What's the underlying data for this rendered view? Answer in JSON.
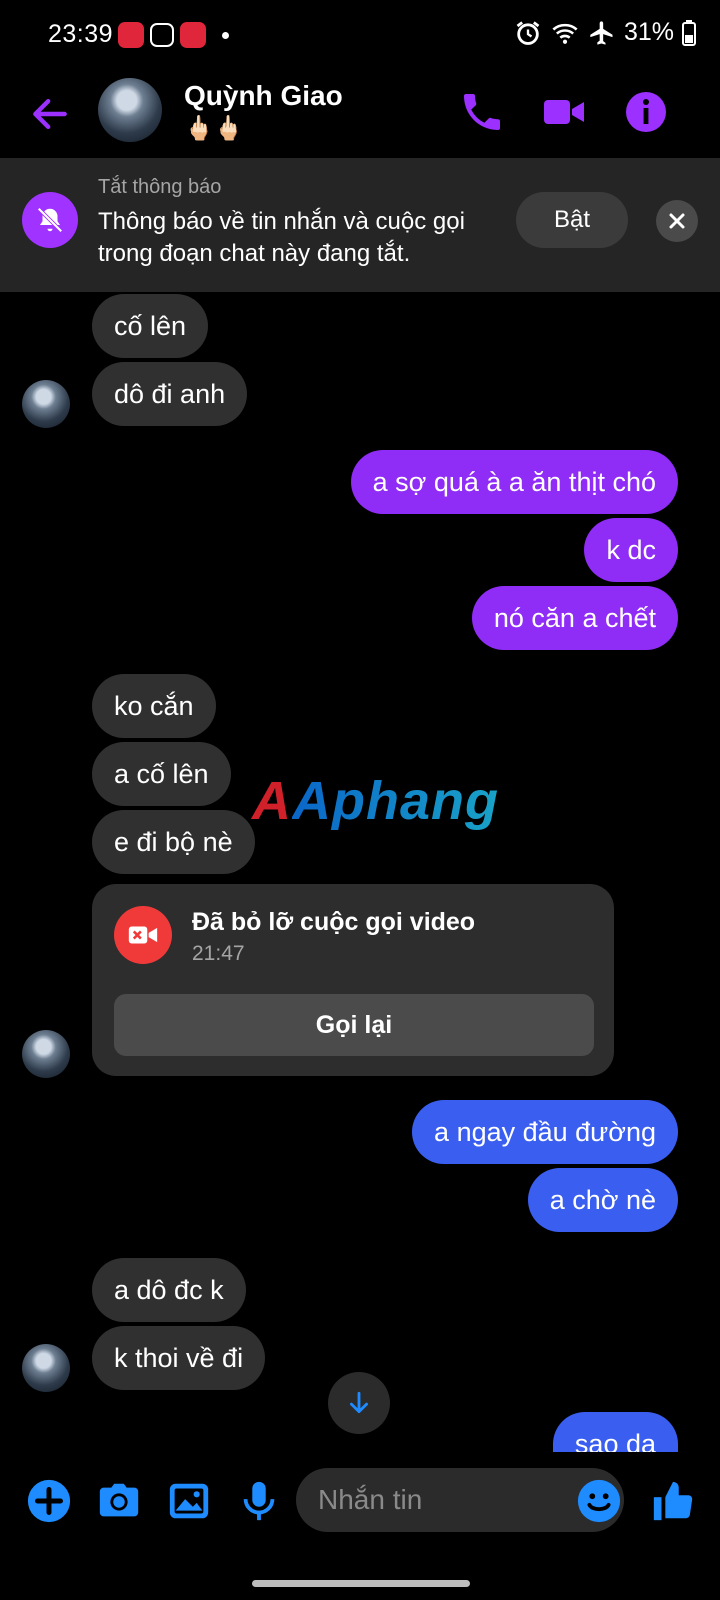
{
  "status_bar": {
    "time": "23:39",
    "battery": "31%"
  },
  "header": {
    "contact_name": "Quỳnh Giao",
    "contact_subtitle": "🖕🏻🖕🏻"
  },
  "mute_banner": {
    "title": "Tắt thông báo",
    "text": "Thông báo về tin nhắn và cuộc gọi trong đoạn chat này đang tắt.",
    "button": "Bật"
  },
  "messages": [
    {
      "side": "in",
      "text": "cố lên"
    },
    {
      "side": "in",
      "text": "dô đi anh"
    },
    {
      "side": "out",
      "text": "a sợ quá à a ăn thịt chó"
    },
    {
      "side": "out",
      "text": "k dc"
    },
    {
      "side": "out",
      "text": "nó căn a chết"
    },
    {
      "side": "in",
      "text": "ko cắn"
    },
    {
      "side": "in",
      "text": "a cố lên"
    },
    {
      "side": "in",
      "text": "e đi bộ nè"
    },
    {
      "side": "out",
      "text": "a ngay đầu đường"
    },
    {
      "side": "out",
      "text": "a chờ nè"
    },
    {
      "side": "in",
      "text": "a dô đc k"
    },
    {
      "side": "in",
      "text": "k thoi về đi"
    },
    {
      "side": "out",
      "text": "sao da"
    }
  ],
  "missed_call": {
    "title": "Đã bỏ lỡ cuộc gọi video",
    "time": "21:47",
    "button": "Gọi lại"
  },
  "watermark": "Aphang",
  "composer": {
    "placeholder": "Nhắn tin"
  },
  "colors": {
    "accent": "#8f2cf5",
    "blue_bubble": "#3a5ff0",
    "composer_icons": "#1e8cff"
  }
}
